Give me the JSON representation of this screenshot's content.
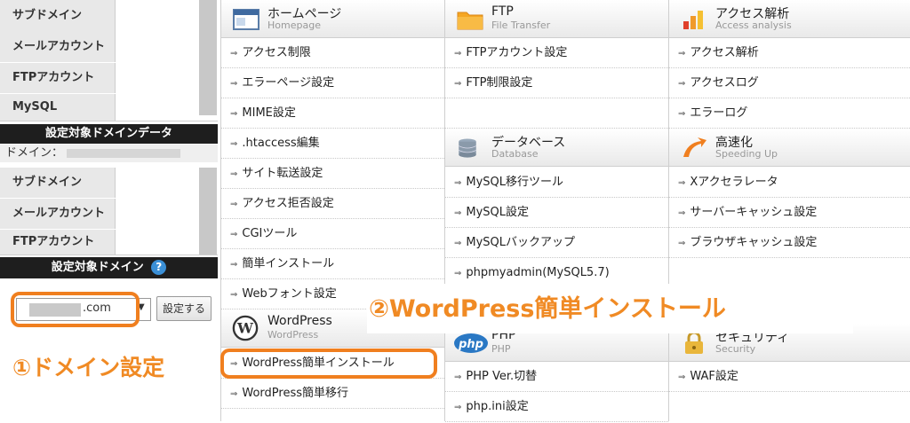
{
  "left_panel": {
    "rows_top": [
      {
        "label": "サブドメイン"
      },
      {
        "label": "メールアカウント"
      },
      {
        "label": "FTPアカウント"
      },
      {
        "label": "MySQL"
      }
    ],
    "domain_data_header": "設定対象ドメインデータ",
    "domain_label": "ドメイン：",
    "rows_bottom": [
      {
        "label": "サブドメイン"
      },
      {
        "label": "メールアカウント"
      },
      {
        "label": "FTPアカウント"
      }
    ],
    "target_domain_header": "設定対象ドメイン",
    "help_glyph": "?",
    "domain_select_value": ".com",
    "set_button": "設定する"
  },
  "columns": [
    {
      "sections": [
        {
          "title": "ホームページ",
          "subtitle": "Homepage",
          "icon": "window-icon",
          "items": [
            "アクセス制限",
            "エラーページ設定",
            "MIME設定",
            ".htaccess編集",
            "サイト転送設定",
            "アクセス拒否設定",
            "CGIツール",
            "簡単インストール",
            "Webフォント設定"
          ]
        },
        {
          "title": "WordPress",
          "subtitle": "WordPress",
          "icon": "wordpress-icon",
          "items": [
            "WordPress簡単インストール",
            "WordPress簡単移行"
          ]
        }
      ]
    },
    {
      "sections": [
        {
          "title": "FTP",
          "subtitle": "File Transfer",
          "icon": "folder-icon",
          "items": [
            "FTPアカウント設定",
            "FTP制限設定",
            ""
          ]
        },
        {
          "title": "データベース",
          "subtitle": "Database",
          "icon": "database-icon",
          "items": [
            "MySQL移行ツール",
            "MySQL設定",
            "MySQLバックアップ",
            "phpmyadmin(MySQL5.7)"
          ]
        },
        {
          "title": "PHP",
          "subtitle": "PHP",
          "icon": "php-icon",
          "items": [
            "PHP Ver.切替",
            "php.ini設定"
          ]
        }
      ]
    },
    {
      "sections": [
        {
          "title": "アクセス解析",
          "subtitle": "Access analysis",
          "icon": "chart-icon",
          "items": [
            "アクセス解析",
            "アクセスログ",
            "エラーログ"
          ]
        },
        {
          "title": "高速化",
          "subtitle": "Speeding Up",
          "icon": "speed-icon",
          "items": [
            "Xアクセラレータ",
            "サーバーキャッシュ設定",
            "ブラウザキャッシュ設定"
          ]
        },
        {
          "title": "セキュリティ",
          "subtitle": "Security",
          "icon": "lock-icon",
          "items": [
            "WAF設定"
          ]
        }
      ]
    }
  ],
  "annotations": {
    "step1": "①ドメイン設定",
    "step2": "②WordPress簡単インストール"
  },
  "colors": {
    "highlight": "#f07f1f",
    "annotation_text": "#f08a24"
  }
}
